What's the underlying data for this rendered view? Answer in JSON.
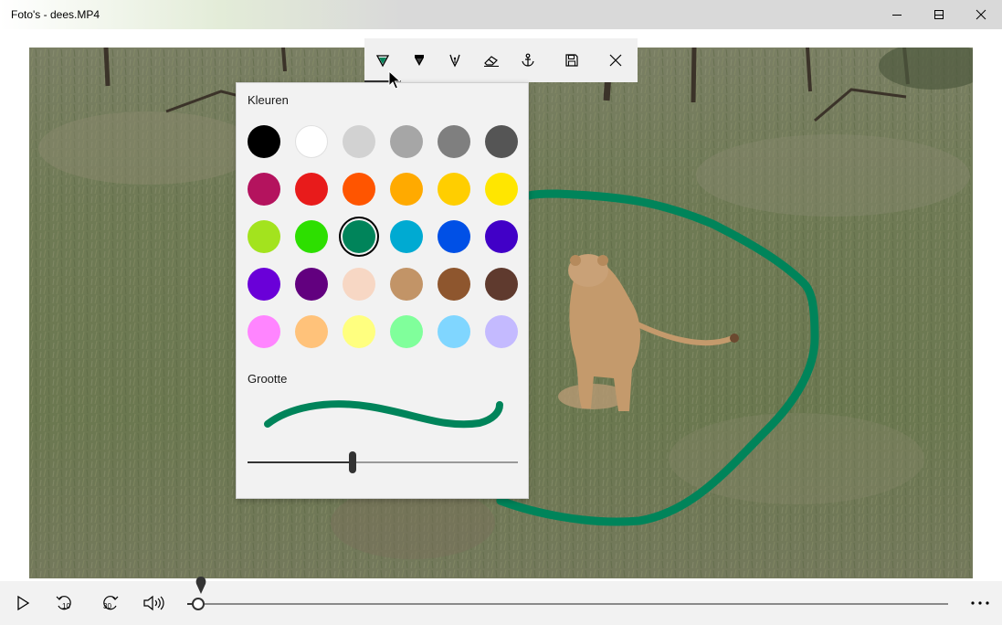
{
  "window": {
    "title": "Foto's - dees.MP4"
  },
  "ink_toolbar": {
    "tools": [
      {
        "name": "ballpoint-pen",
        "active": true
      },
      {
        "name": "pencil"
      },
      {
        "name": "calligraphy-pen"
      },
      {
        "name": "eraser"
      },
      {
        "name": "anchor"
      },
      {
        "name": "save"
      },
      {
        "name": "close"
      }
    ]
  },
  "panel": {
    "colors_label": "Kleuren",
    "size_label": "Grootte",
    "selected_color": "#00845a",
    "colors": [
      "#000000",
      "#ffffff",
      "#d2d2d2",
      "#a6a6a6",
      "#7f7f7f",
      "#555555",
      "#b4135e",
      "#e81b1b",
      "#ff5500",
      "#ffaa00",
      "#ffce00",
      "#ffe600",
      "#a3e31e",
      "#2ddf00",
      "#00845a",
      "#00aad2",
      "#0050e6",
      "#4100c7",
      "#6a00d8",
      "#62007f",
      "#f7d7c4",
      "#c29467",
      "#8e562e",
      "#5f3a2e",
      "#ff85ff",
      "#ffc27a",
      "#ffff7f",
      "#80ff9b",
      "#80d6ff",
      "#c4baff"
    ],
    "size_value": 0.39
  },
  "playback": {
    "progress": 0.015
  },
  "colors": {
    "ink": "#00845a",
    "panel_bg": "#f2f2f2",
    "toolbar_bg": "#f0f0f0"
  }
}
